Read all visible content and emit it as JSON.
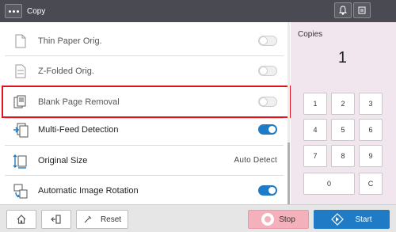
{
  "titlebar": {
    "title": "Copy",
    "menu_icon": "more-icon",
    "bell_icon": "bell-icon",
    "status_icon": "device-status-icon"
  },
  "settings": [
    {
      "label": "Thin Paper Orig.",
      "icon": "thin-paper-icon",
      "control": "toggle",
      "state": "off",
      "enabled": false
    },
    {
      "label": "Z-Folded Orig.",
      "icon": "z-folded-icon",
      "control": "toggle",
      "state": "off",
      "enabled": false
    },
    {
      "label": "Blank Page Removal",
      "icon": "blank-page-removal-icon",
      "control": "toggle",
      "state": "off",
      "enabled": false,
      "highlighted": true
    },
    {
      "label": "Multi-Feed Detection",
      "icon": "multi-feed-icon",
      "control": "toggle",
      "state": "on",
      "enabled": true
    },
    {
      "label": "Original Size",
      "icon": "original-size-icon",
      "control": "value",
      "value": "Auto  Detect",
      "enabled": true
    },
    {
      "label": "Automatic Image Rotation",
      "icon": "image-rotation-icon",
      "control": "toggle",
      "state": "on",
      "enabled": true
    }
  ],
  "copies": {
    "label": "Copies",
    "value": "1"
  },
  "keypad": {
    "k1": "1",
    "k2": "2",
    "k3": "3",
    "k4": "4",
    "k5": "5",
    "k6": "6",
    "k7": "7",
    "k8": "8",
    "k9": "9",
    "k0": "0",
    "kc": "C"
  },
  "bottombar": {
    "home_icon": "home-icon",
    "logout_icon": "logout-icon",
    "reset_label": "Reset",
    "stop_label": "Stop",
    "start_label": "Start"
  },
  "colors": {
    "accent": "#1f7bc6",
    "highlight": "#e0141e",
    "stop": "#f4b0bb",
    "keypad_bg": "#f2e6ee",
    "titlebar": "#4a4a52"
  }
}
